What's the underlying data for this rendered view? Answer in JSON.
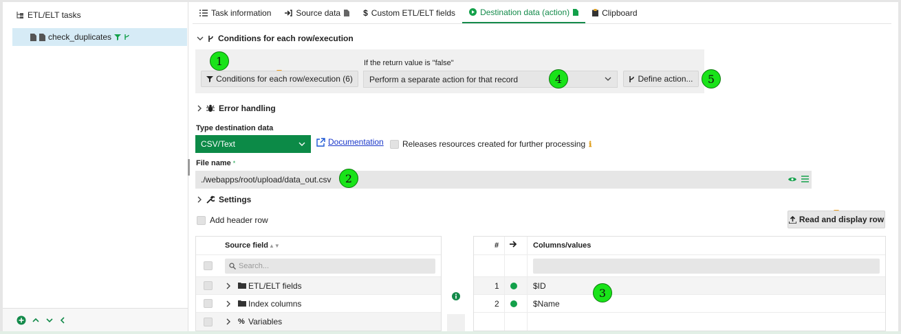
{
  "sidebar": {
    "root_label": "ETL/ELT tasks",
    "selected_item": "check_duplicates"
  },
  "tabs": [
    {
      "label": "Task information"
    },
    {
      "label": "Source data"
    },
    {
      "label": "Custom ETL/ELT fields"
    },
    {
      "label": "Destination data (action)"
    },
    {
      "label": "Clipboard"
    }
  ],
  "conditions": {
    "section_title": "Conditions for each row/execution",
    "button_label": "Conditions for each row/execution (6)",
    "false_label": "If the return value is \"false\"",
    "action_select": "Perform a separate action for that record",
    "define_button": "Define action..."
  },
  "error_handling": {
    "title": "Error handling"
  },
  "destination": {
    "type_label": "Type destination data",
    "type_value": "CSV/Text",
    "doc_link": "Documentation",
    "release_label": "Releases resources created for further processing"
  },
  "file": {
    "label": "File name",
    "required_mark": "*",
    "value": "./webapps/root/upload/data_out.csv"
  },
  "settings": {
    "title": "Settings"
  },
  "header_row": {
    "label": "Add header row"
  },
  "read_button": "Read and display row",
  "source_grid": {
    "header": "Source field",
    "search_placeholder": "Search...",
    "rows": [
      "ETL/ELT fields",
      "Index columns",
      "Variables"
    ]
  },
  "dest_grid": {
    "col_num": "#",
    "col_values": "Columns/values",
    "rows": [
      {
        "num": "1",
        "value": "$ID"
      },
      {
        "num": "2",
        "value": "$Name"
      }
    ]
  },
  "callouts": [
    "1",
    "2",
    "3",
    "4",
    "5"
  ],
  "colors": {
    "accent": "#138a4a",
    "callout": "#19e319"
  }
}
